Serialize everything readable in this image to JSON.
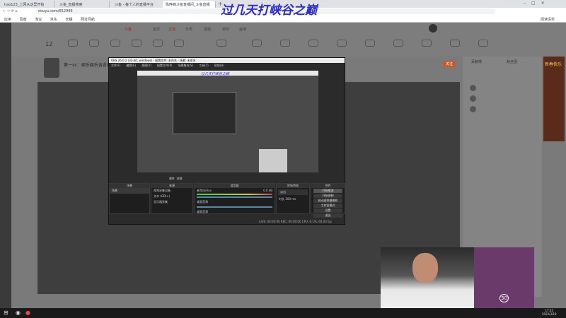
{
  "browser": {
    "tabs": [
      "hao123_上网从这里开始",
      "斗鱼_直播搜索",
      "斗鱼 - 每个人的直播平台",
      "陈晔峰斗鱼直播间_斗鱼直播"
    ],
    "url": "douyu.com/652999",
    "bookmarks": [
      "应用",
      "百度",
      "淘宝",
      "京东",
      "天猫",
      "网址导航"
    ],
    "reading_list": "阅读清单"
  },
  "overlay_text": "过几天打峡谷之巅",
  "site": {
    "logo": "斗鱼",
    "nav": [
      "首页",
      "直播",
      "分类",
      "视频",
      "游戏",
      "鱼吧"
    ],
    "follow_count": "12",
    "streamer_title": "第一vc：娱乐娱乐吉吉播",
    "follow_button": "关注",
    "sidebar_tabs": [
      "贡献榜",
      "粉丝团"
    ],
    "ad_text": "新春快乐"
  },
  "obs": {
    "title": "OBS 26.0.2 (32-bit, windows) - 配置文件: 未命名 - 场景: 未命名",
    "menu": [
      "文件(F)",
      "编辑(E)",
      "视图(V)",
      "配置文件(P)",
      "场景集合(S)",
      "工具(T)",
      "帮助(H)"
    ],
    "docks": {
      "scenes": "场景",
      "sources": "来源",
      "mixer": "混音器",
      "transitions": "转场特效",
      "controls": "控件"
    },
    "scene_items": [
      "场景"
    ],
    "source_items": [
      "视频采集设备",
      "文本 (GDI+)",
      "显示器采集"
    ],
    "mixer_items": [
      "麦克风/Aux",
      "桌面音频",
      "桌面音频"
    ],
    "mixer_db": "0.0 dB",
    "transition": "淡出",
    "duration_label": "时长",
    "duration": "300 ms",
    "controls": [
      "开始推流",
      "开始录制",
      "启动虚拟摄像机",
      "工作室模式",
      "设置",
      "退出"
    ],
    "toolbar": [
      "属性",
      "滤镜"
    ],
    "status": "LIVE: 00:00:00   REC: 00:00:00   CPU: 6.1%, 60.00 fps"
  },
  "taskbar": {
    "time": "17:55",
    "date": "2022/3/18"
  },
  "gift": {
    "count": "30"
  }
}
